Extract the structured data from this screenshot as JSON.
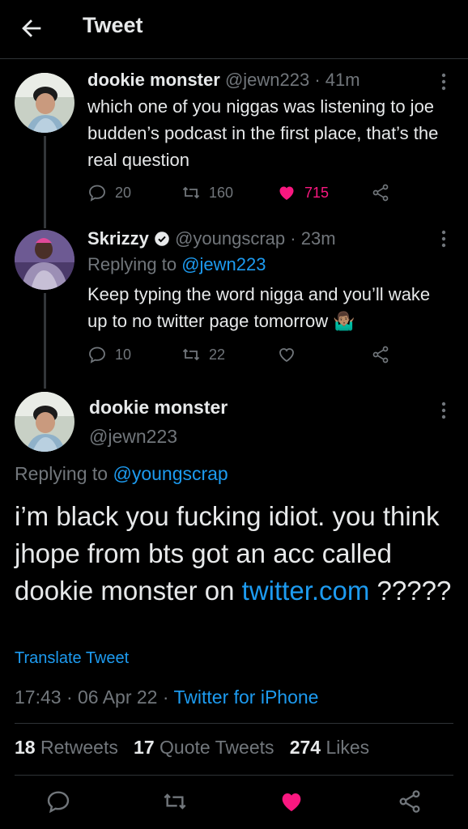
{
  "header": {
    "title": "Tweet"
  },
  "thread": [
    {
      "name": "dookie monster",
      "handle": "@jewn223",
      "time": "· 41m",
      "text": "which one of you niggas was listening to joe budden’s podcast in the first place, that’s the real question",
      "replies": "20",
      "retweets": "160",
      "likes": "715"
    },
    {
      "name": "Skrizzy",
      "handle": "@youngscrap",
      "time": "· 23m",
      "replying_prefix": "Replying to",
      "replying_to": "@jewn223",
      "text": "Keep typing the word nigga and you’ll wake up to no twitter page tomorrow 🤷🏽‍♂️",
      "replies": "10",
      "retweets": "22",
      "likes": ""
    }
  ],
  "main": {
    "name": "dookie monster",
    "handle": "@jewn223",
    "replying_prefix": "Replying to",
    "replying_to": "@youngscrap",
    "text_before_link": "i’m black you fucking idiot. you think jhope from bts got an acc called dookie monster on",
    "link": "twitter.com",
    "text_after_link": " ?????",
    "translate": "Translate Tweet",
    "timestamp": "17:43 · 06 Apr 22 ·",
    "client": "Twitter for iPhone",
    "retweets_count": "18",
    "retweets_label": "Retweets",
    "quotes_count": "17",
    "quotes_label": "Quote Tweets",
    "likes_count": "274",
    "likes_label": "Likes"
  },
  "colors": {
    "accent": "#1d9bf0",
    "like": "#f91880",
    "muted": "#71767b"
  }
}
